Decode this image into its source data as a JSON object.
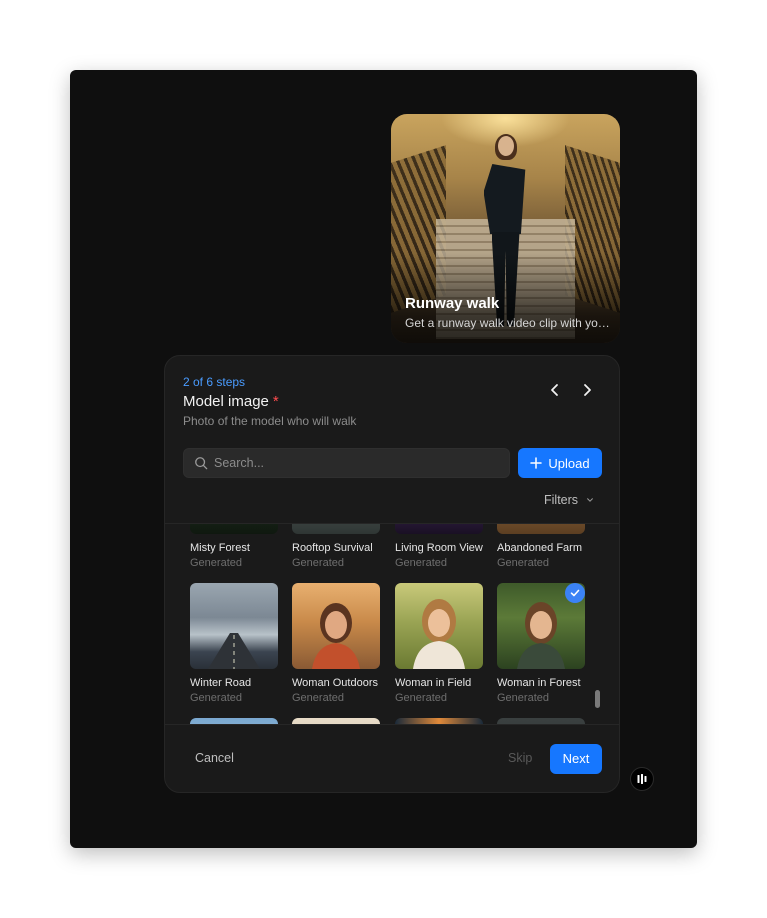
{
  "hero": {
    "title": "Runway walk",
    "subtitle": "Get a runway walk video clip with your model"
  },
  "panel": {
    "steps": "2 of 6 steps",
    "title": "Model image",
    "required_mark": "*",
    "description": "Photo of the model who will walk",
    "nav_prev": "‹",
    "nav_next": "›"
  },
  "search": {
    "placeholder": "Search...",
    "value": ""
  },
  "upload": {
    "label": "Upload"
  },
  "filters": {
    "label": "Filters"
  },
  "grid": {
    "row1": [
      {
        "name": "Misty Forest",
        "tag": "Generated"
      },
      {
        "name": "Rooftop Survival",
        "tag": "Generated"
      },
      {
        "name": "Living Room View",
        "tag": "Generated"
      },
      {
        "name": "Abandoned Farm",
        "tag": "Generated"
      }
    ],
    "row2": [
      {
        "name": "Winter Road",
        "tag": "Generated"
      },
      {
        "name": "Woman Outdoors",
        "tag": "Generated"
      },
      {
        "name": "Woman in Field",
        "tag": "Generated"
      },
      {
        "name": "Woman in Forest",
        "tag": "Generated",
        "selected": true
      }
    ]
  },
  "footer": {
    "cancel": "Cancel",
    "skip": "Skip",
    "next": "Next"
  },
  "colors": {
    "accent": "#1677ff",
    "steps": "#4a9cff",
    "required": "#ff4d4f",
    "check": "#3b82f6"
  }
}
